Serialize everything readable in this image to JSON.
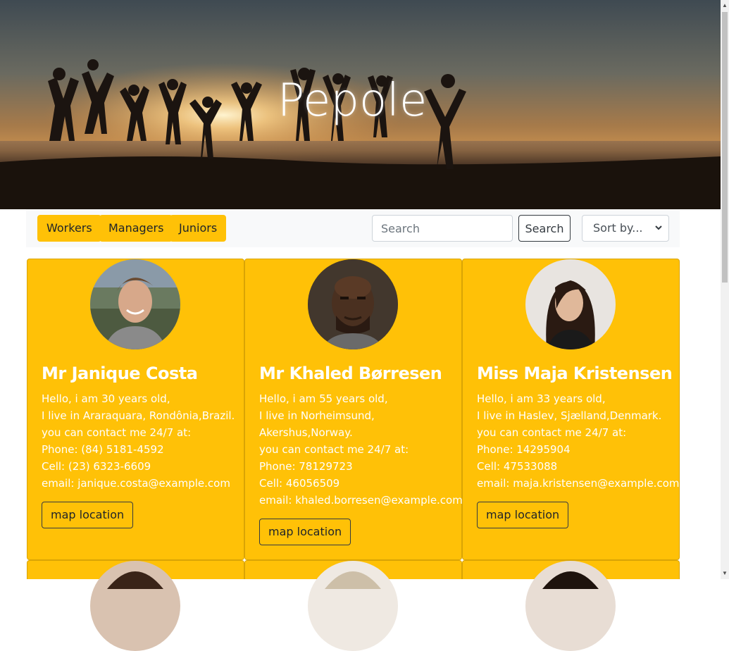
{
  "header": {
    "title": "Pepole"
  },
  "toolbar": {
    "filters": [
      "Workers",
      "Managers",
      "Juniors"
    ],
    "search_placeholder": "Search",
    "search_label": "Search",
    "sort_label": "Sort by..."
  },
  "cards": [
    {
      "name": "Mr Janique Costa",
      "lines": [
        "Hello, i am 30 years old,",
        "I live in Araraquara, Rondônia,Brazil.",
        "you can contact me 24/7 at:",
        "Phone: (84) 5181-4592",
        "Cell: (23) 6323-6609",
        "email: janique.costa@example.com"
      ],
      "map_label": "map location"
    },
    {
      "name": "Mr Khaled Børresen",
      "lines": [
        "Hello, i am 55 years old,",
        "I live in Norheimsund,",
        "Akershus,Norway.",
        "you can contact me 24/7 at:",
        "Phone: 78129723",
        "Cell: 46056509",
        "email: khaled.borresen@example.com"
      ],
      "map_label": "map location"
    },
    {
      "name": "Miss Maja Kristensen",
      "lines": [
        "Hello, i am 33 years old,",
        "I live in Haslev, Sjælland,Denmark.",
        "you can contact me 24/7 at:",
        "Phone: 14295904",
        "Cell: 47533088",
        "email: maja.kristensen@example.com"
      ],
      "map_label": "map location"
    }
  ],
  "colors": {
    "card_bg": "#ffc107",
    "toolbar_bg": "#f8f9fa"
  }
}
